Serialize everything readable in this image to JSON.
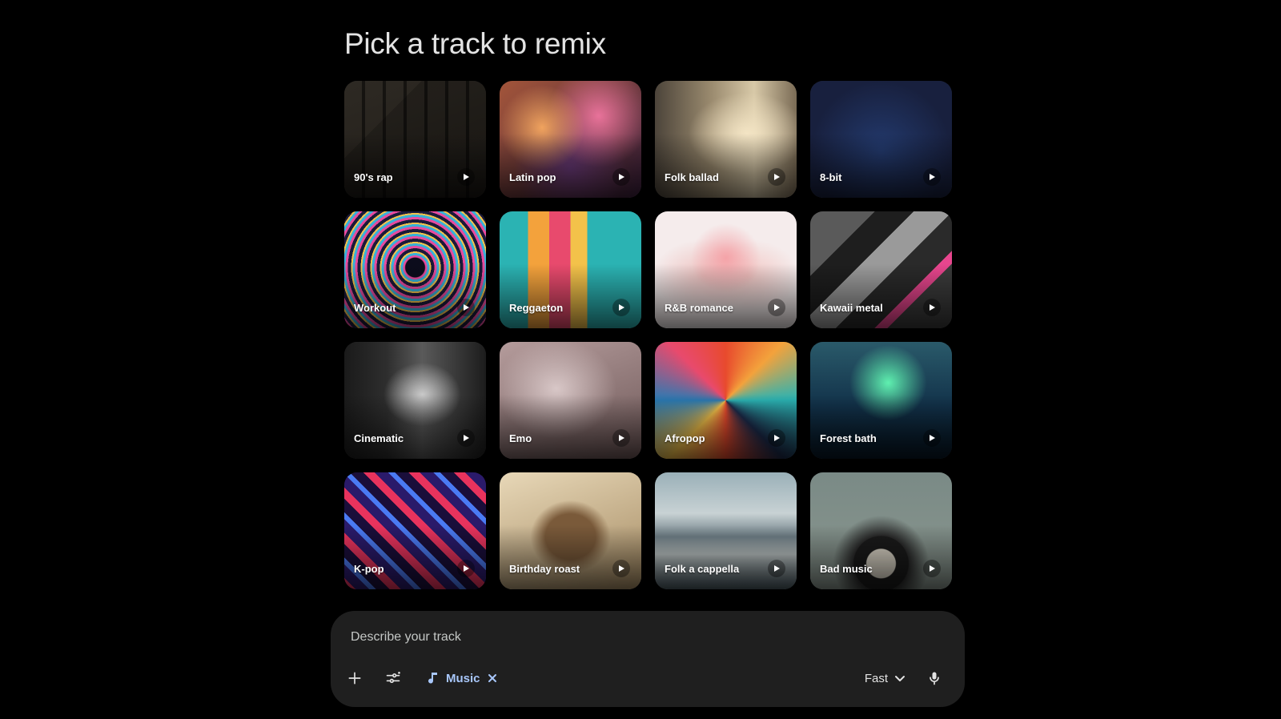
{
  "page": {
    "title": "Pick a track to remix"
  },
  "tracks": [
    {
      "label": "90's rap",
      "art": "art-rap"
    },
    {
      "label": "Latin pop",
      "art": "art-latin"
    },
    {
      "label": "Folk ballad",
      "art": "art-folk"
    },
    {
      "label": "8-bit",
      "art": "art-8bit"
    },
    {
      "label": "Workout",
      "art": "art-workout"
    },
    {
      "label": "Reggaeton",
      "art": "art-reggaeton"
    },
    {
      "label": "R&B romance",
      "art": "art-rnb"
    },
    {
      "label": "Kawaii metal",
      "art": "art-kawaii"
    },
    {
      "label": "Cinematic",
      "art": "art-cinematic"
    },
    {
      "label": "Emo",
      "art": "art-emo"
    },
    {
      "label": "Afropop",
      "art": "art-afropop"
    },
    {
      "label": "Forest bath",
      "art": "art-forest"
    },
    {
      "label": "K-pop",
      "art": "art-kpop"
    },
    {
      "label": "Birthday roast",
      "art": "art-birthday"
    },
    {
      "label": "Folk a cappella",
      "art": "art-acappella"
    },
    {
      "label": "Bad music",
      "art": "art-bad"
    }
  ],
  "composer": {
    "placeholder": "Describe your track",
    "chip_label": "Music",
    "mode_label": "Fast",
    "icons": {
      "add": "plus-icon",
      "tools": "tune-icon",
      "chip": "music-note-icon",
      "remove": "close-icon",
      "mode": "chevron-down-icon",
      "voice": "microphone-icon",
      "play": "play-icon"
    }
  },
  "colors": {
    "background": "#000000",
    "panel": "#1f1f1f",
    "accent": "#a8c7fa",
    "title": "#e3e3e3"
  }
}
